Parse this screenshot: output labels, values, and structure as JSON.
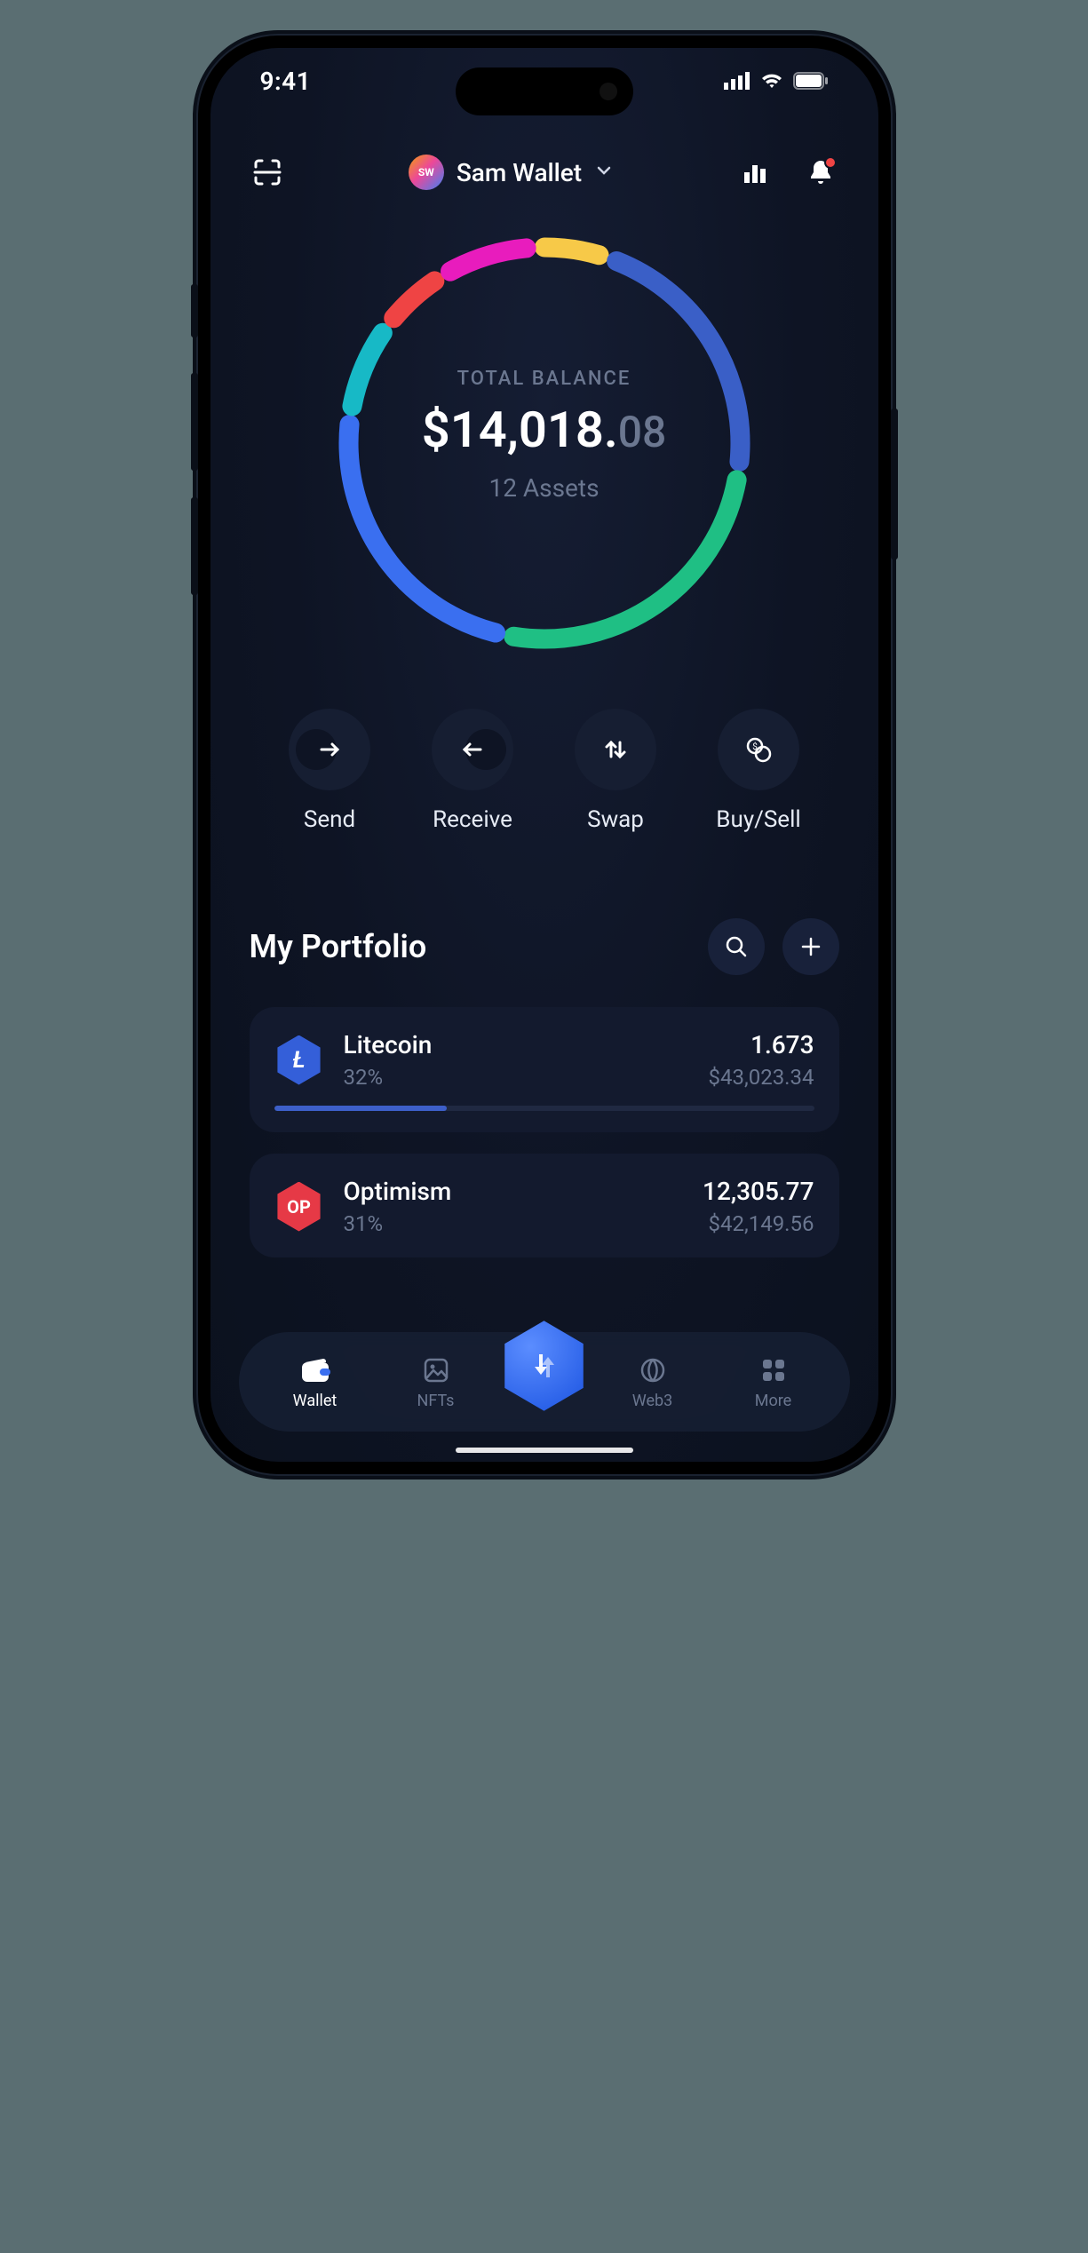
{
  "status": {
    "time": "9:41"
  },
  "header": {
    "avatar_initials": "SW",
    "wallet_name": "Sam Wallet"
  },
  "balance": {
    "label": "TOTAL BALANCE",
    "currency": "$",
    "whole": "14,018.",
    "cents": "08",
    "assets_text": "12 Assets"
  },
  "chart_data": {
    "type": "pie",
    "title": "Portfolio allocation",
    "series": [
      {
        "name": "seg1",
        "value": 6,
        "color": "#f7c948"
      },
      {
        "name": "seg2",
        "value": 22,
        "color": "#3a5fc7"
      },
      {
        "name": "seg3",
        "value": 26,
        "color": "#1fbf84"
      },
      {
        "name": "seg4",
        "value": 24,
        "color": "#3a6ff0"
      },
      {
        "name": "seg5",
        "value": 8,
        "color": "#17b9c6"
      },
      {
        "name": "seg6",
        "value": 6,
        "color": "#ef4444"
      },
      {
        "name": "seg7",
        "value": 8,
        "color": "#e81cbd"
      }
    ]
  },
  "actions": {
    "send": {
      "label": "Send"
    },
    "receive": {
      "label": "Receive"
    },
    "swap": {
      "label": "Swap"
    },
    "buysell": {
      "label": "Buy/Sell"
    }
  },
  "portfolio": {
    "title": "My Portfolio",
    "assets": [
      {
        "name": "Litecoin",
        "pct": "32%",
        "amount": "1.673",
        "fiat": "$43,023.34",
        "progress": 32,
        "symbol": "Ł",
        "cls": "ltc"
      },
      {
        "name": "Optimism",
        "pct": "31%",
        "amount": "12,305.77",
        "fiat": "$42,149.56",
        "progress": 31,
        "symbol": "OP",
        "cls": "op"
      }
    ]
  },
  "tabs": {
    "wallet": "Wallet",
    "nfts": "NFTs",
    "web3": "Web3",
    "more": "More"
  }
}
